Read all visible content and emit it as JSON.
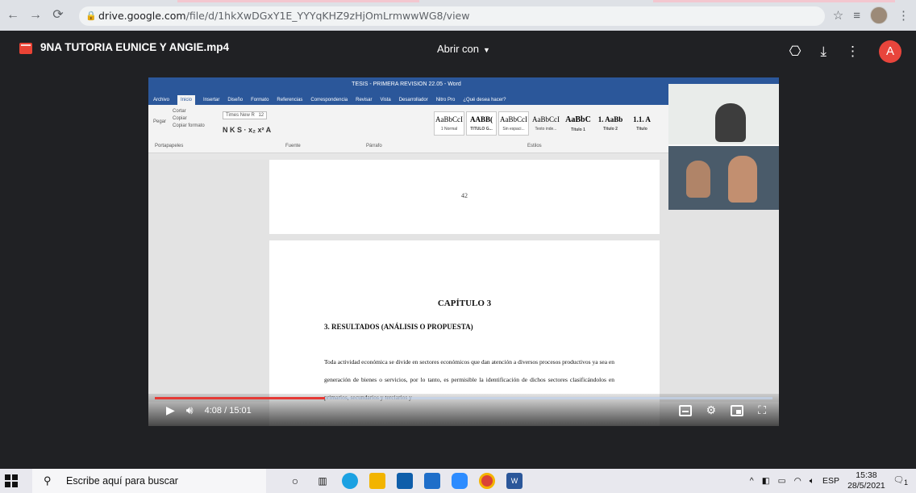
{
  "browser": {
    "url_host": "drive.google.com",
    "url_path": "/file/d/1hkXwDGxY1E_YYYqKHZ9zHjOmLrmwwWG8/view"
  },
  "drive": {
    "file_name": "9NA TUTORIA EUNICE Y ANGIE.mp4",
    "open_with_label": "Abrir con",
    "avatar_letter": "A"
  },
  "word": {
    "title": "TESIS - PRIMERA REVISION 22.05 - Word",
    "menu": [
      "Archivo",
      "Inicio",
      "Insertar",
      "Diseño",
      "Formato",
      "Referencias",
      "Correspondencia",
      "Revisar",
      "Vista",
      "Desarrollador",
      "Nitro Pro",
      "¿Qué desea hacer?"
    ],
    "clipboard": {
      "paste": "Pegar",
      "cut": "Cortar",
      "copy": "Copiar",
      "format_painter": "Copiar formato",
      "group": "Portapapeles"
    },
    "font_name": "Times New R",
    "font_size": "12",
    "groups": {
      "font": "Fuente",
      "paragraph": "Párrafo",
      "styles": "Estilos"
    },
    "styles": [
      {
        "sample": "AaBbCcI",
        "label": "1 Normal"
      },
      {
        "sample": "AABB(",
        "label": "TITULO G..."
      },
      {
        "sample": "AaBbCcI",
        "label": "Sin espaci..."
      },
      {
        "sample": "AaBbCcI",
        "label": "Texto inde..."
      },
      {
        "sample": "AaBbC",
        "label": "Título 1"
      },
      {
        "sample": "1. AaBb",
        "label": "Título 2"
      },
      {
        "sample": "1.1. A",
        "label": "Título"
      }
    ],
    "page_number": "42",
    "chapter_title": "CAPÍTULO 3",
    "chapter_subtitle": "3.   RESULTADOS (ANÁLISIS O PROPUESTA)",
    "paragraph": "Toda actividad económica se divide en sectores económicos que dan atención a diversos procesos productivos ya sea en generación de bienes o servicios, por lo tanto, es permisible la identificación de dichos sectores clasificándolos en primarios, secundarios y terciarios y"
  },
  "player": {
    "current_time": "4:08",
    "duration": "15:01",
    "progress_fraction": 0.275
  },
  "taskbar": {
    "search_placeholder": "Escribe aquí para buscar",
    "language": "ESP",
    "time": "15:38",
    "date": "28/5/2021",
    "notification_count": "1"
  },
  "colors": {
    "chrome_bar": "#dee1e6",
    "drive_bg": "#202124",
    "word_blue": "#2b579a",
    "progress_red": "#e53935",
    "avatar_red": "#e8453c"
  }
}
